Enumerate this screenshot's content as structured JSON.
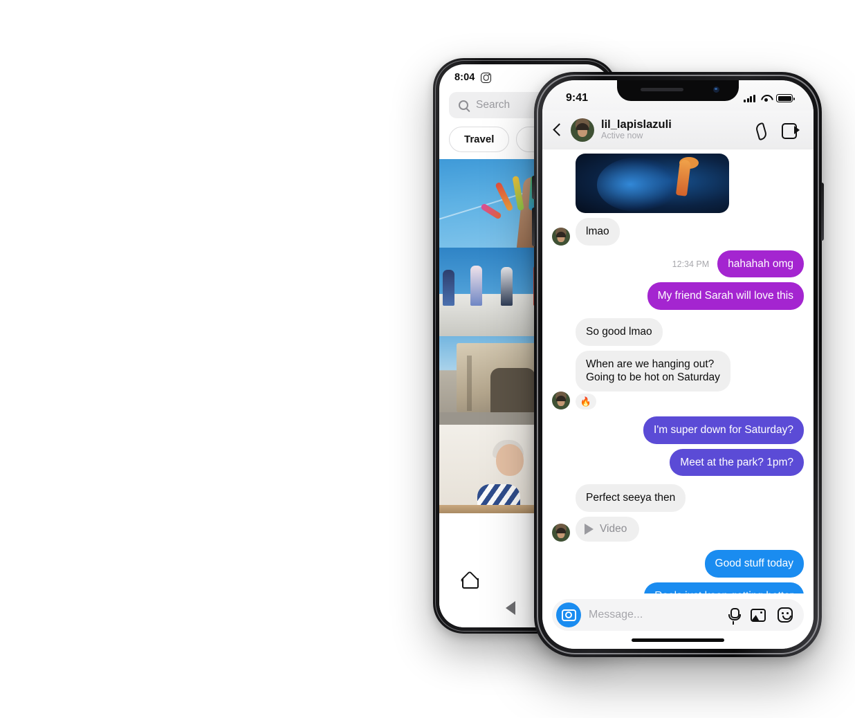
{
  "back_phone": {
    "status": {
      "time": "8:04",
      "app_icon": "instagram-icon"
    },
    "search": {
      "placeholder": "Search",
      "icon": "search-icon"
    },
    "chips": [
      {
        "label": "Travel"
      },
      {
        "label": ""
      }
    ],
    "grid": [
      {
        "name": "rainbow-hand-sky",
        "badge": "carousel-icon"
      },
      {
        "name": "group-of-friends-on-ledge",
        "badge": ""
      },
      {
        "name": "stone-triumphal-arch",
        "badge": ""
      },
      {
        "name": "woman-eating-by-window",
        "badge": ""
      }
    ],
    "nav": [
      {
        "icon": "home-icon"
      },
      {
        "icon": "search-icon"
      }
    ],
    "system_back": "back-triangle-icon"
  },
  "front_phone": {
    "status": {
      "time": "9:41",
      "signal": "cellular-bars-icon",
      "wifi": "wifi-icon",
      "battery": "battery-icon"
    },
    "header": {
      "back": "chevron-left-icon",
      "avatar": "avatar",
      "name": "lil_lapislazuli",
      "presence": "Active now",
      "call": "phone-icon",
      "video": "video-camera-icon"
    },
    "messages": [
      {
        "kind": "media",
        "side": "in",
        "caption": "",
        "avatar": false
      },
      {
        "kind": "text",
        "side": "in",
        "text": "lmao",
        "avatar": true
      },
      {
        "kind": "text",
        "side": "out",
        "text": "hahahah omg",
        "stamp": "12:34 PM",
        "color": "#a425d0"
      },
      {
        "kind": "text",
        "side": "out",
        "text": "My friend Sarah will love this",
        "color": "#a425d0"
      },
      {
        "kind": "text",
        "side": "in",
        "text": "So good lmao",
        "avatar": false
      },
      {
        "kind": "text",
        "side": "in",
        "text": "When are we hanging out?\nGoing to be hot on Saturday",
        "avatar": true,
        "reaction": "🔥"
      },
      {
        "kind": "text",
        "side": "out",
        "text": "I'm super down for Saturday?",
        "color": "#5b4bd6"
      },
      {
        "kind": "text",
        "side": "out",
        "text": "Meet at the park? 1pm?",
        "color": "#5b4bd6"
      },
      {
        "kind": "text",
        "side": "in",
        "text": "Perfect seeya then",
        "avatar": false
      },
      {
        "kind": "video",
        "side": "in",
        "text": "Video",
        "avatar": true
      },
      {
        "kind": "text",
        "side": "out",
        "text": "Good stuff today",
        "color": "#1a8cf0"
      },
      {
        "kind": "text",
        "side": "out",
        "text": "Reels just keep getting better",
        "color": "#1a8cf0"
      }
    ],
    "composer": {
      "camera": "camera-icon",
      "placeholder": "Message...",
      "mic": "microphone-icon",
      "gallery": "image-icon",
      "sticker": "sticker-icon"
    }
  },
  "colors": {
    "magenta": "#a425d0",
    "indigo": "#5b4bd6",
    "blue": "#1a8cf0",
    "incoming": "#efefef"
  }
}
